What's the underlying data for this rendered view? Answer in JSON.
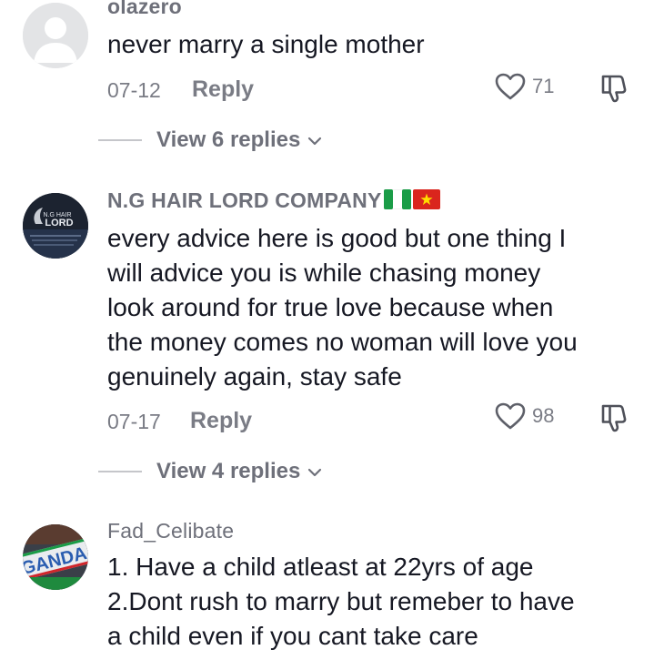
{
  "comments": [
    {
      "username": "olazero",
      "text": "never marry a single mother",
      "date": "07-12",
      "reply_label": "Reply",
      "likes": "71",
      "view_replies": "View 6 replies"
    },
    {
      "username": "N.G HAIR LORD COMPANY",
      "avatar_text_1": "N.G HAIR",
      "avatar_text_2": "LORD",
      "text": "every advice here is good but one thing I\nwill advice you is while chasing money\nlook around for true love because when\nthe money comes no woman will love you\ngenuinely again, stay safe",
      "date": "07-17",
      "reply_label": "Reply",
      "likes": "98",
      "view_replies": "View 4 replies"
    },
    {
      "username": "Fad_Celibate",
      "avatar_text": "GANDA",
      "text": "1. Have a child atleast at 22yrs of age\n2.Dont rush to marry but remeber to have\na child even if you cant take care"
    }
  ],
  "icons": {
    "like": "heart-outline-icon",
    "dislike": "thumbs-down-outline-icon",
    "chevron": "chevron-down-icon",
    "flags": [
      "nigeria-flag-icon",
      "vietnam-flag-icon"
    ]
  },
  "colors": {
    "text_primary": "#161823",
    "text_secondary": "#6e707a",
    "divider": "#c5c6ca",
    "nigeria_green": "#1a9c47",
    "vietnam_red": "#da251d",
    "vietnam_star": "#ffde00"
  }
}
